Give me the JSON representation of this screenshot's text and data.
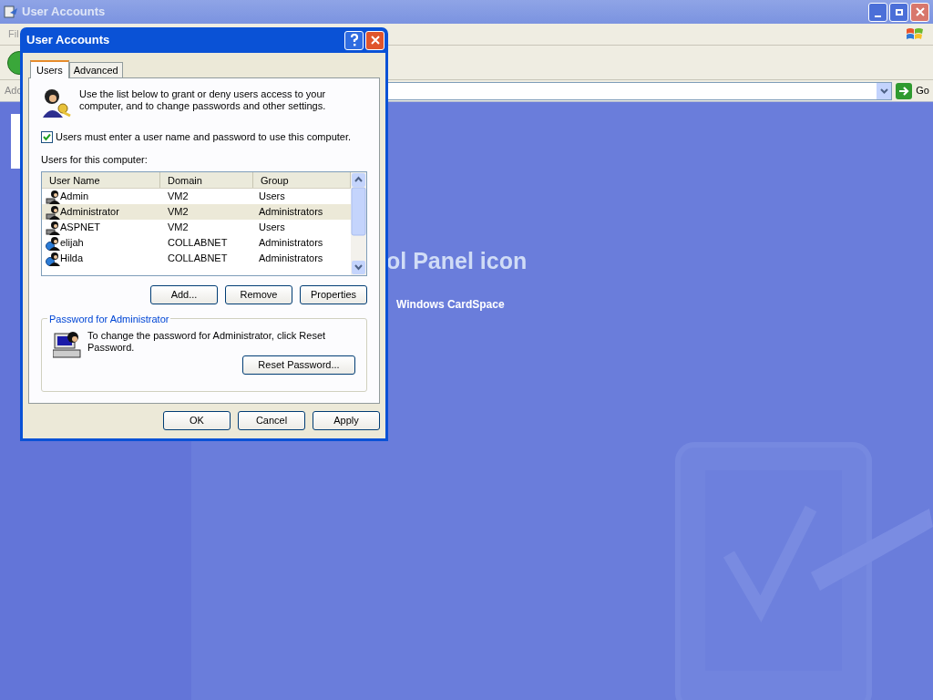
{
  "window": {
    "title": "User Accounts",
    "menu_text": "Fil",
    "address_label": "Add",
    "go": "Go"
  },
  "content": {
    "heading": "ol Panel icon",
    "link": "Windows CardSpace"
  },
  "dialog": {
    "title": "User Accounts",
    "tabs": [
      {
        "label": "Users",
        "selected": true
      },
      {
        "label": "Advanced",
        "selected": false
      }
    ],
    "intro": "Use the list below to grant or deny users access to your computer, and to change passwords and other settings.",
    "require_login": {
      "label": "Users must enter a user name and password to use this computer.",
      "checked": true
    },
    "list_label": "Users for this computer:",
    "columns": [
      "User Name",
      "Domain",
      "Group"
    ],
    "rows": [
      {
        "name": "Admin",
        "domain": "VM2",
        "group": "Users",
        "kind": "local",
        "selected": false
      },
      {
        "name": "Administrator",
        "domain": "VM2",
        "group": "Administrators",
        "kind": "local",
        "selected": true
      },
      {
        "name": "ASPNET",
        "domain": "VM2",
        "group": "Users",
        "kind": "local",
        "selected": false
      },
      {
        "name": "elijah",
        "domain": "COLLABNET",
        "group": "Administrators",
        "kind": "domain",
        "selected": false
      },
      {
        "name": "Hilda",
        "domain": "COLLABNET",
        "group": "Administrators",
        "kind": "domain",
        "selected": false
      }
    ],
    "buttons": [
      "Add...",
      "Remove",
      "Properties"
    ],
    "password_group": {
      "title": "Password for Administrator",
      "text": "To change the password for Administrator, click Reset Password.",
      "button": "Reset Password..."
    },
    "footer_buttons": [
      "OK",
      "Cancel",
      "Apply"
    ]
  }
}
